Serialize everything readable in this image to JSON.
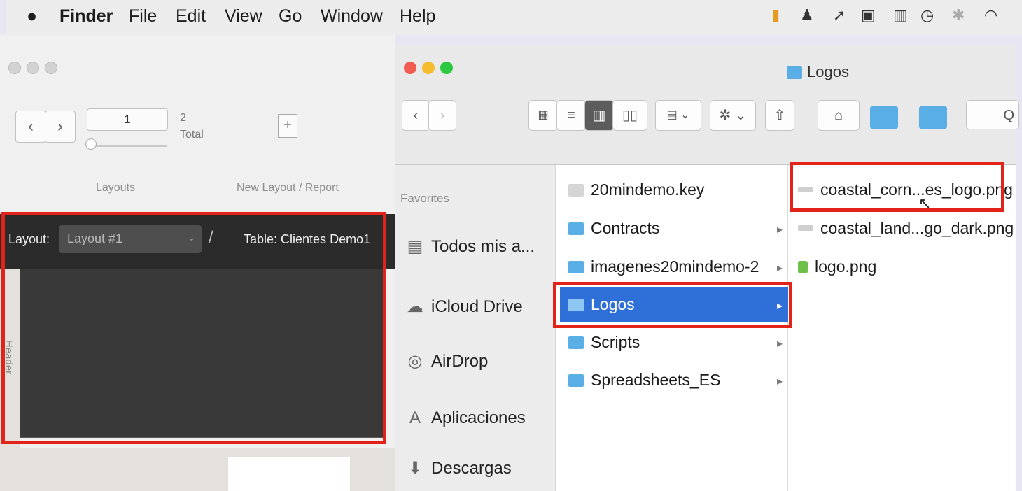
{
  "menubar": {
    "apple": "",
    "app_name": "Finder",
    "items": [
      "File",
      "Edit",
      "View",
      "Go",
      "Window",
      "Help"
    ]
  },
  "filemaker": {
    "record_number": "1",
    "total_count": "2",
    "total_label": "Total",
    "layouts_label": "Layouts",
    "new_layout_label": "New Layout / Report",
    "layout_prefix": "Layout:",
    "layout_value": "Layout #1",
    "table_label": "Table: Clientes Demo1",
    "header_part_label": "Header"
  },
  "finder": {
    "title": "Logos",
    "search_placeholder": "Q",
    "sidebar_heading": "Favorites",
    "sidebar_items": [
      "Todos mis a...",
      "iCloud Drive",
      "AirDrop",
      "Aplicaciones",
      "Descargas"
    ],
    "column1": [
      "20mindemo.key",
      "Contracts",
      "imagenes20mindemo-2",
      "Logos",
      "Scripts",
      "Spreadsheets_ES"
    ],
    "column2": [
      "coastal_corn...es_logo.png",
      "coastal_land...go_dark.png",
      "logo.png"
    ]
  },
  "colors": {
    "highlight_red": "#e2231a",
    "selection_blue": "#2f6fd8",
    "folder_blue": "#5aaee6"
  }
}
